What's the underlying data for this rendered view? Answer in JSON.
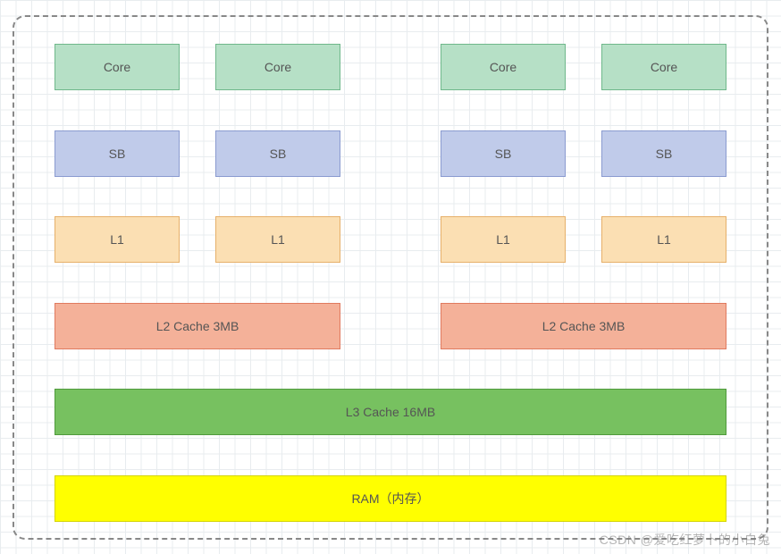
{
  "rows": {
    "cores": [
      "Core",
      "Core",
      "Core",
      "Core"
    ],
    "sb": [
      "SB",
      "SB",
      "SB",
      "SB"
    ],
    "l1": [
      "L1",
      "L1",
      "L1",
      "L1"
    ],
    "l2": [
      "L2 Cache 3MB",
      "L2 Cache 3MB"
    ],
    "l3": "L3 Cache 16MB",
    "ram": "RAM（内存）"
  },
  "colors": {
    "core": "#b6e0c6",
    "sb": "#c0cbea",
    "l1": "#fbdfb3",
    "l2": "#f4b199",
    "l3": "#77c160",
    "ram": "#ffff00"
  },
  "watermark": "CSDN @爱吃红萝卜的小白兔"
}
